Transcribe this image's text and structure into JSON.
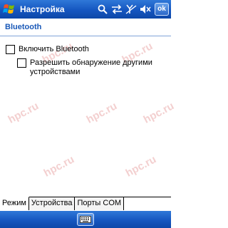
{
  "titlebar": {
    "title": "Настройка",
    "ok_label": "ok",
    "icons": [
      "windows-logo-icon",
      "search-icon",
      "connectivity-icon",
      "no-signal-icon",
      "volume-icon"
    ]
  },
  "header": {
    "title": "Bluetooth"
  },
  "options": {
    "enable_label": "Включить Bluetooth",
    "enable_checked": false,
    "discoverable_label": "Разрешить обнаружение другими устройствами",
    "discoverable_checked": false
  },
  "watermark": {
    "text": "hpc.ru"
  },
  "tabs": [
    {
      "label": "Режим",
      "active": true
    },
    {
      "label": "Устройства",
      "active": false
    },
    {
      "label": "Порты COM",
      "active": false
    }
  ],
  "menubar": {
    "sip_icon": "keyboard-icon"
  },
  "colors": {
    "titlebar": "#1556c0",
    "header_text": "#1a59b8",
    "watermark": "#f2c8c8"
  }
}
